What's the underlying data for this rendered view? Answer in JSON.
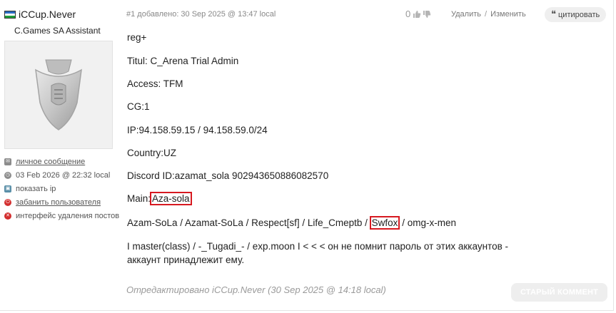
{
  "user": {
    "name": "iCCup.Never",
    "role": "C.Games SA Assistant",
    "flag_colors": [
      "#2a6cc4",
      "#ffffff",
      "#1f9e3a"
    ],
    "menu": [
      {
        "icon": "message-icon",
        "label": "личное сообщение",
        "link": true,
        "color": "#8c8c8c"
      },
      {
        "icon": "clock-icon",
        "label": "03 Feb 2026 @ 22:32 local",
        "link": false,
        "color": "#8c8c8c"
      },
      {
        "icon": "monitor-icon",
        "label": "показать ip",
        "link": false,
        "color": "#5a8fa8"
      },
      {
        "icon": "ban-icon",
        "label": "забанить пользователя",
        "link": true,
        "color": "#d32f2f"
      },
      {
        "icon": "delete-icon",
        "label": "интерфейс удаления постов",
        "link": false,
        "color": "#d32f2f"
      }
    ]
  },
  "post": {
    "meta": "#1 добавлено: 30 Sep 2025 @ 13:47 local",
    "rating": "0",
    "actions": {
      "delete": "Удалить",
      "separator": "/",
      "edit": "Изменить"
    },
    "quote": "цитировать",
    "lines": {
      "l1": "reg+",
      "l2": "Titul: C_Arena Trial Admin",
      "l3": "Access: TFM",
      "l4": "CG:1",
      "l5": "IP:94.158.59.15 / 94.158.59.0/24",
      "l6": "Country:UZ",
      "l7": "Discord ID:azamat_sola 902943650886082570",
      "l8_prefix": "Main:",
      "l8_highlight": "Aza-sola",
      "l9_prefix": "Azam-SoLa / Azamat-SoLa / Respect[sf] / Life_Cmeptb / ",
      "l9_highlight": "Swfox",
      "l9_suffix": " / omg-x-men",
      "l10": "I master(class) / -_Tugadi_- / exp.moon I < < < он не помнит пароль от этих аккаунтов -",
      "l11": "аккаунт принадлежит ему."
    },
    "edited": "Отредактировано iCCup.Never (30 Sep 2025 @ 14:18 local)",
    "old_comment_button": "СТАРЫЙ КОММЕНТ",
    "highlight_color": "#d71920"
  }
}
